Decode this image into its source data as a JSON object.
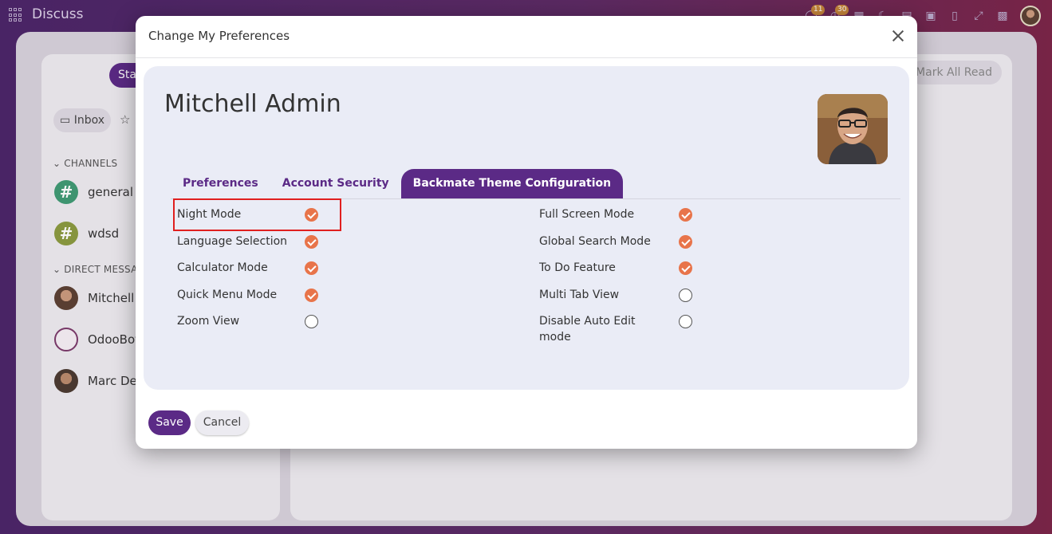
{
  "app": {
    "title": "Discuss"
  },
  "topbar": {
    "badges": {
      "messages": "11",
      "activities": "30"
    },
    "icons": [
      "apps-icon",
      "chat-icon",
      "clock-icon",
      "grid-icon",
      "moon-icon",
      "calculator-icon",
      "translate-icon",
      "bookmark-icon",
      "fullscreen-icon",
      "building-icon",
      "avatar"
    ]
  },
  "background": {
    "start_label": "Sta",
    "inbox_label": "Inbox",
    "channels_header": "CHANNELS",
    "channels": [
      {
        "name": "general",
        "color": "#3f9a73"
      },
      {
        "name": "wdsd",
        "color": "#8a9a3f"
      }
    ],
    "dm_header": "DIRECT MESSAG",
    "direct_messages": [
      {
        "name": "Mitchell A"
      },
      {
        "name": "OdooBot"
      },
      {
        "name": "Marc Dem"
      }
    ],
    "mark_all_read": "Mark All Read"
  },
  "dialog": {
    "title": "Change My Preferences",
    "user_name": "Mitchell Admin",
    "tabs": [
      {
        "label": "Preferences",
        "active": false
      },
      {
        "label": "Account Security",
        "active": false
      },
      {
        "label": "Backmate Theme Configuration",
        "active": true
      }
    ],
    "left_options": [
      {
        "label": "Night Mode",
        "checked": true
      },
      {
        "label": "Language Selection",
        "checked": true
      },
      {
        "label": "Calculator Mode",
        "checked": true
      },
      {
        "label": "Quick Menu Mode",
        "checked": true
      },
      {
        "label": "Zoom View",
        "checked": false
      }
    ],
    "right_options": [
      {
        "label": "Full Screen Mode",
        "checked": true
      },
      {
        "label": "Global Search Mode",
        "checked": true
      },
      {
        "label": "To Do Feature",
        "checked": true
      },
      {
        "label": "Multi Tab View",
        "checked": false
      },
      {
        "label": "Disable Auto Edit",
        "label2": "mode",
        "checked": false
      }
    ],
    "save_label": "Save",
    "cancel_label": "Cancel"
  },
  "colors": {
    "accent": "#5b2a86",
    "check": "#e8744a",
    "highlight": "#e01f1f"
  }
}
